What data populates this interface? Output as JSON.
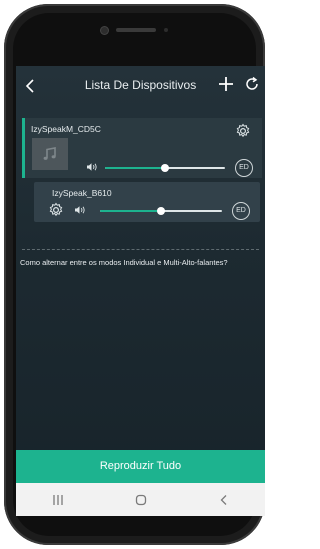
{
  "header": {
    "title": "Lista De Dispositivos",
    "back_icon": "back-arrow-icon",
    "add_icon": "plus-icon",
    "refresh_icon": "refresh-icon"
  },
  "devices": [
    {
      "name": "IzySpeakM_CD5C",
      "volume": 0.5,
      "eq_badge": "ED",
      "role": "master"
    },
    {
      "name": "IzySpeak_B610",
      "volume": 0.5,
      "eq_badge": "ED",
      "role": "slave"
    }
  ],
  "help": {
    "text": "Como alternar entre os modos Individual e Multi-Alto-falantes?"
  },
  "footer": {
    "play_all_label": "Reproduzir Tudo"
  },
  "navbar": {
    "items": [
      "recent-apps-icon",
      "home-icon",
      "back-icon"
    ]
  },
  "colors": {
    "accent": "#1db38f",
    "background": "#1d2a31",
    "card": "#2b3a41"
  }
}
